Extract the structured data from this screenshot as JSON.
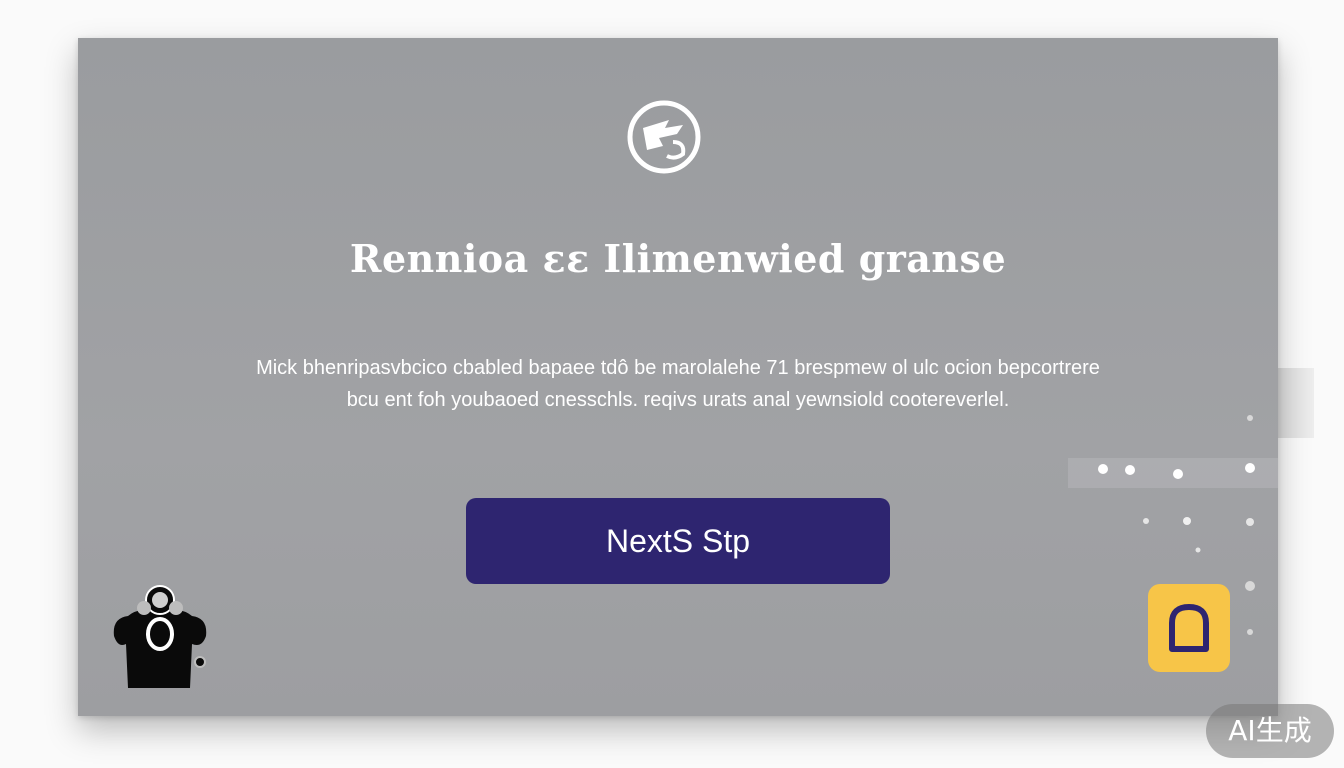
{
  "dialog": {
    "title": "Rennioa ɛɛ  Ilimenwied    granse",
    "body_line1": "Mick bhenripasvbcico cbabled bapaee tdô be marolalehe 71 brespmew ol ulc ocion bepcortrere",
    "body_line2": "bcu ent foh youbaoed cnesschls. reqivs urats anal yewnsiold cootereverlel.",
    "next_button_label": "NextS Stp"
  },
  "icons": {
    "logo": "circular-brand-logo-icon",
    "mascot": "mascot-character-icon",
    "help": "chat-bubble-icon"
  },
  "colors": {
    "card_background": "#9d9ea1",
    "primary_button": "#2e2570",
    "help_button": "#f7c548",
    "text": "#ffffff"
  },
  "watermark": "AI生成"
}
